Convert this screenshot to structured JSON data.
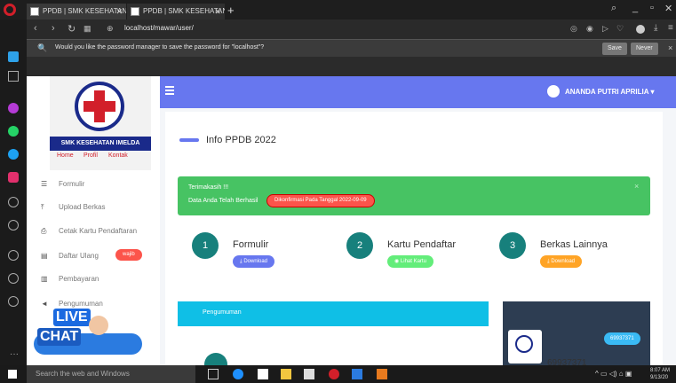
{
  "browser": {
    "tabs": [
      {
        "label": "PPDB | SMK KESEHATAN IM"
      },
      {
        "label": "PPDB | SMK KESEHATAN IM"
      }
    ],
    "new_tab": "+",
    "url": "localhost/mawar/user/",
    "password_prompt": "Would you like the password manager to save the password for \"localhost\"?",
    "save_label": "Save",
    "never_label": "Never"
  },
  "header": {
    "username": "ANANDA PUTRI APRILIA"
  },
  "brand": {
    "school": "SMK KESEHATAN IMELDA",
    "links": [
      "Home",
      "Profil",
      "Kontak"
    ]
  },
  "sidebar": {
    "items": [
      {
        "label": "Formulir",
        "icon": "list-icon"
      },
      {
        "label": "Upload Berkas",
        "icon": "upload-icon"
      },
      {
        "label": "Cetak Kartu Pendaftaran",
        "icon": "print-icon"
      },
      {
        "label": "Daftar Ulang",
        "icon": "id-card-icon",
        "badge": "wajib"
      },
      {
        "label": "Pembayaran",
        "icon": "money-icon"
      },
      {
        "label": "Pengumuman",
        "icon": "megaphone-icon"
      }
    ]
  },
  "live_chat": {
    "line1": "LIVE",
    "line2": "CHAT"
  },
  "main": {
    "title": "Info PPDB 2022",
    "alert": {
      "line1": "Terimakasih !!!",
      "line2": "Data Anda Telah Berhasil",
      "badge": "Dikonfirmasi Pada Tanggal 2022-09-09"
    },
    "steps": [
      {
        "number": "1",
        "title": "Formulir",
        "button": "Download",
        "color": "#6777ef"
      },
      {
        "number": "2",
        "title": "Kartu Pendaftar",
        "button": "Lihat Kartu",
        "color": "#63ed7a"
      },
      {
        "number": "3",
        "title": "Berkas Lainnya",
        "button": "Download",
        "color": "#ffa426"
      }
    ],
    "announcement": "Pengumuman",
    "stat_badge": "69937371",
    "stat_number": "69937371"
  },
  "taskbar": {
    "search": "Search the web and Windows",
    "time": "8:07 AM",
    "date": "9/13/20"
  }
}
